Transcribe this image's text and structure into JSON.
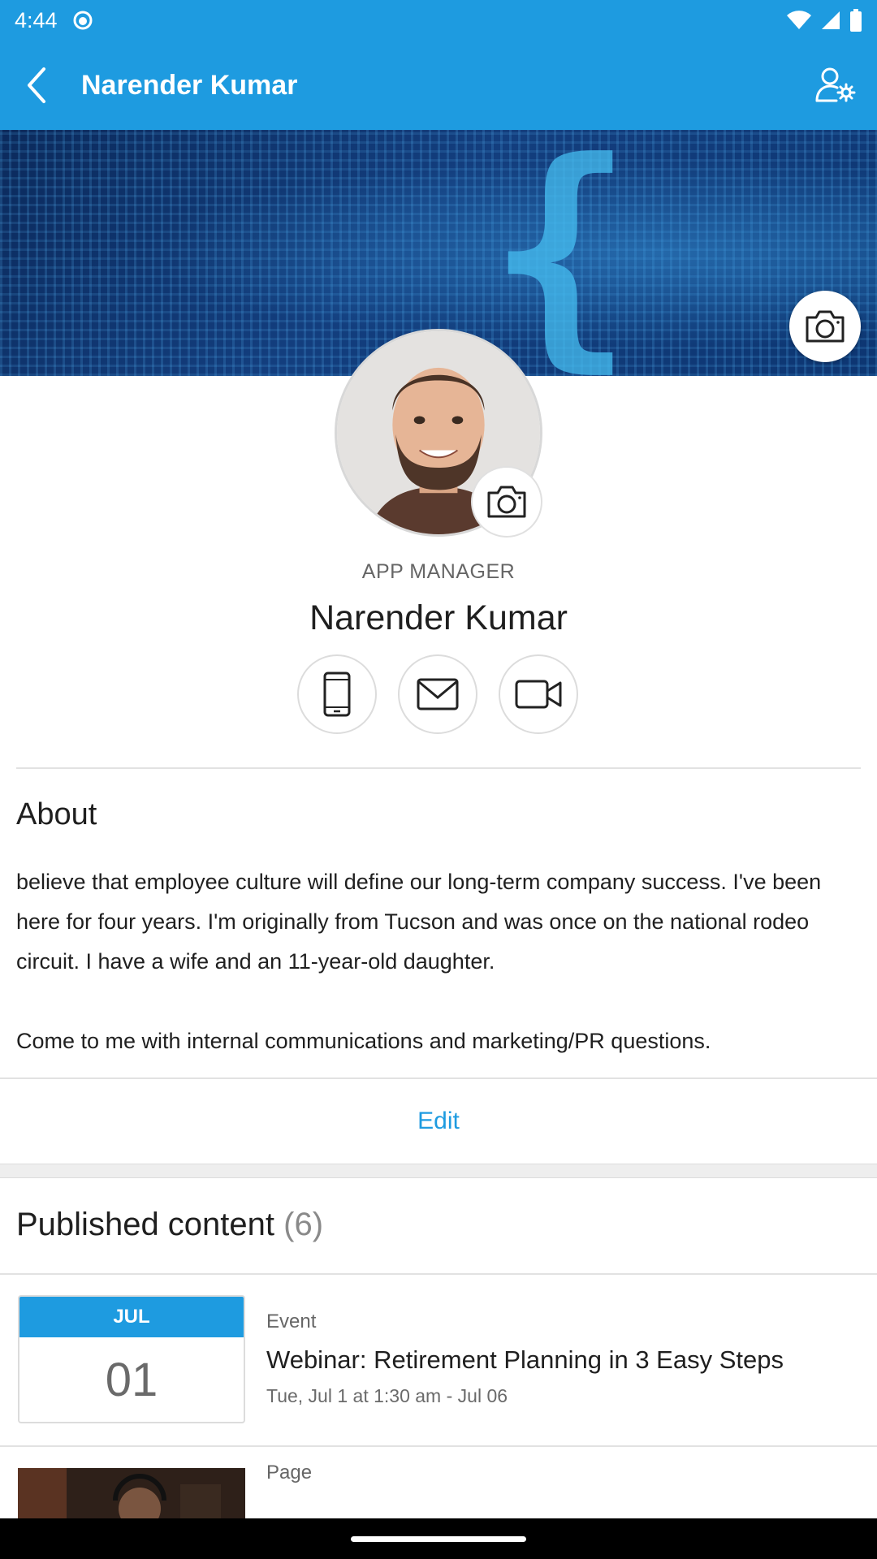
{
  "status_bar": {
    "time": "4:44",
    "icons": [
      "app-notification-icon",
      "wifi-icon",
      "signal-icon",
      "battery-icon"
    ]
  },
  "app_bar": {
    "title": "Narender Kumar",
    "back_icon": "back-arrow-icon",
    "settings_icon": "user-settings-icon",
    "color": "#1e9be0"
  },
  "cover": {
    "decoration": "{ }",
    "camera_icon": "camera-icon"
  },
  "profile": {
    "role": "APP MANAGER",
    "name": "Narender Kumar",
    "contact_icons": [
      "phone-icon",
      "email-icon",
      "video-call-icon"
    ]
  },
  "about": {
    "heading": "About",
    "text": "believe that employee culture will define our long-term company success. I've been here for four years. I'm originally from Tucson and was once on the national rodeo circuit. I have a wife and an 11-year-old daughter.\n\nCome to me with internal communications and marketing/PR questions."
  },
  "edit_label": "Edit",
  "published": {
    "heading": "Published content",
    "count": "(6)",
    "items": [
      {
        "type": "Event",
        "month": "JUL",
        "day": "01",
        "title": "Webinar: Retirement Planning in 3 Easy Steps",
        "subtitle": "Tue, Jul 1 at 1:30 am - Jul 06"
      },
      {
        "type": "Page"
      }
    ]
  }
}
